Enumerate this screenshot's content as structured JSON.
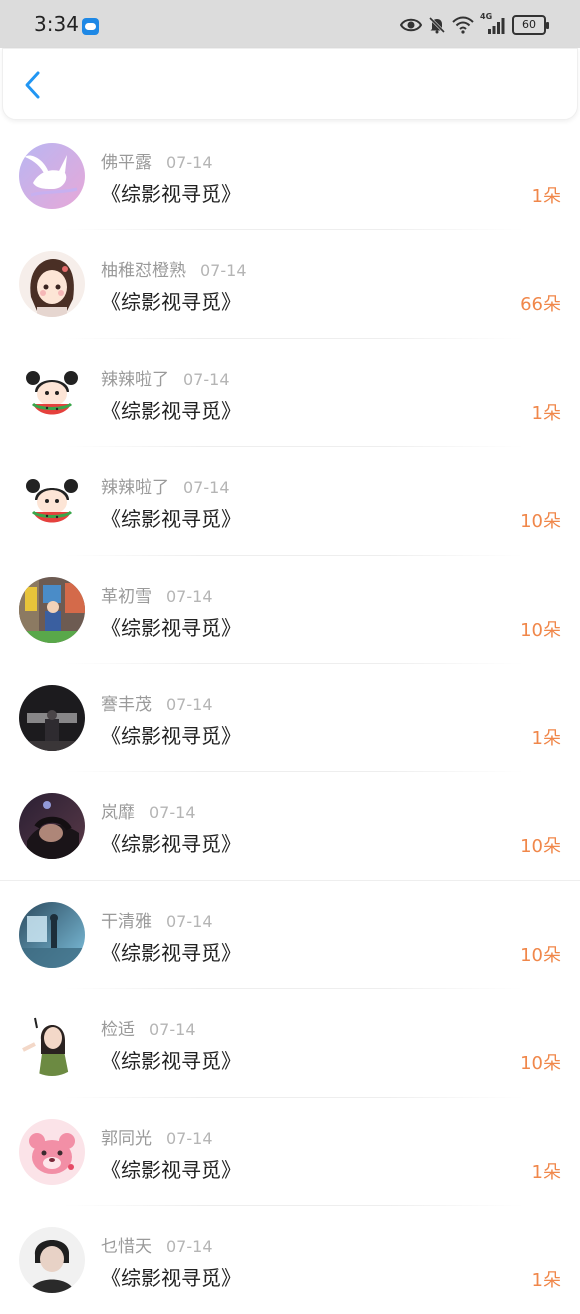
{
  "status_bar": {
    "time": "3:34",
    "network_label": "4G",
    "battery": "60",
    "icons": [
      "app-badge-icon",
      "eye-icon",
      "bell-muted-icon",
      "wifi-icon",
      "signal-icon",
      "battery-icon"
    ]
  },
  "nav": {
    "back_icon": "chevron-left-icon",
    "accent": "#2196f3"
  },
  "colors": {
    "amount": "#f0874a",
    "name": "#9a9a9a",
    "title": "#222222"
  },
  "records": [
    {
      "name": "佛平露",
      "date": "07-14",
      "title": "《综影视寻觅》",
      "amount": "1朵"
    },
    {
      "name": "柚稚怼橙熟",
      "date": "07-14",
      "title": "《综影视寻觅》",
      "amount": "66朵"
    },
    {
      "name": "辣辣啦了",
      "date": "07-14",
      "title": "《综影视寻觅》",
      "amount": "1朵"
    },
    {
      "name": "辣辣啦了",
      "date": "07-14",
      "title": "《综影视寻觅》",
      "amount": "10朵"
    },
    {
      "name": "革初雪",
      "date": "07-14",
      "title": "《综影视寻觅》",
      "amount": "10朵"
    },
    {
      "name": "謇丰茂",
      "date": "07-14",
      "title": "《综影视寻觅》",
      "amount": "1朵"
    },
    {
      "name": "岚靡",
      "date": "07-14",
      "title": "《综影视寻觅》",
      "amount": "10朵"
    },
    {
      "name": "干清雅",
      "date": "07-14",
      "title": "《综影视寻觅》",
      "amount": "10朵"
    },
    {
      "name": "检适",
      "date": "07-14",
      "title": "《综影视寻觅》",
      "amount": "10朵"
    },
    {
      "name": "郭同光",
      "date": "07-14",
      "title": "《综影视寻觅》",
      "amount": "1朵"
    },
    {
      "name": "乜惜天",
      "date": "07-14",
      "title": "《综影视寻觅》",
      "amount": "1朵"
    }
  ]
}
